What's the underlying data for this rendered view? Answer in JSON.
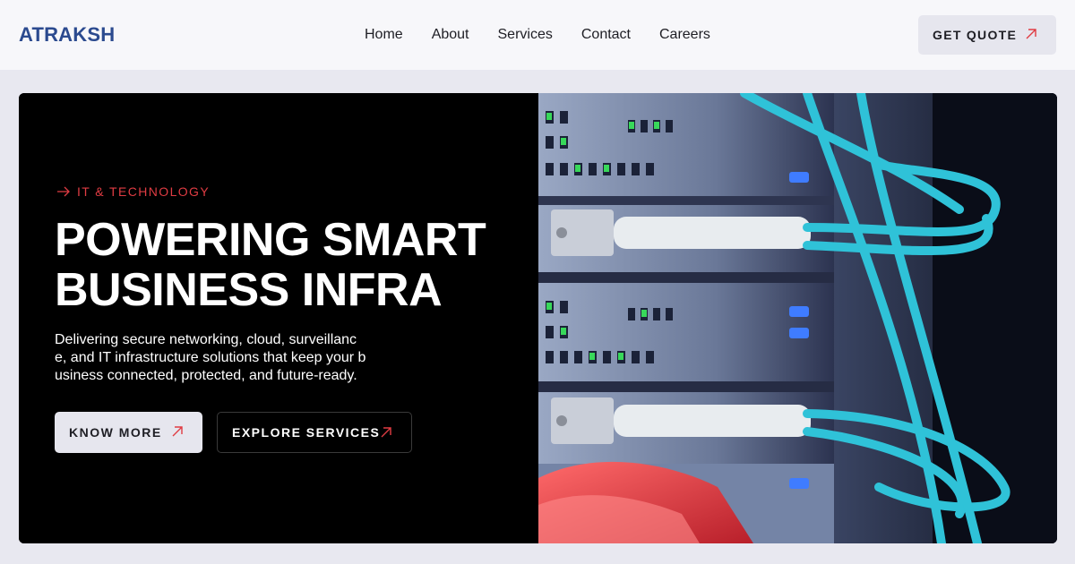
{
  "brand": {
    "name": "ATRAKSH"
  },
  "nav": {
    "items": [
      "Home",
      "About",
      "Services",
      "Contact",
      "Careers"
    ]
  },
  "header": {
    "cta_label": "GET QUOTE"
  },
  "hero": {
    "eyebrow": "IT & TECHNOLOGY",
    "title_line1": "POWERING SMART",
    "title_line2": "BUSINESS INFRA",
    "description": "Delivering secure networking, cloud, surveillance, and IT infrastructure solutions that keep your business connected, protected, and future-ready.",
    "primary_label": "KNOW MORE",
    "secondary_label": "EXPLORE SERVICES"
  },
  "icons": {
    "arrow_up_right": "arrow-up-right-icon",
    "arrow_right": "arrow-right-icon",
    "hero_image": "server-fiber-cables-image"
  },
  "colors": {
    "accent": "#e03c43",
    "brand": "#2b4a8f",
    "hero_bg": "#000000",
    "page_bg": "#e8e8f0"
  }
}
